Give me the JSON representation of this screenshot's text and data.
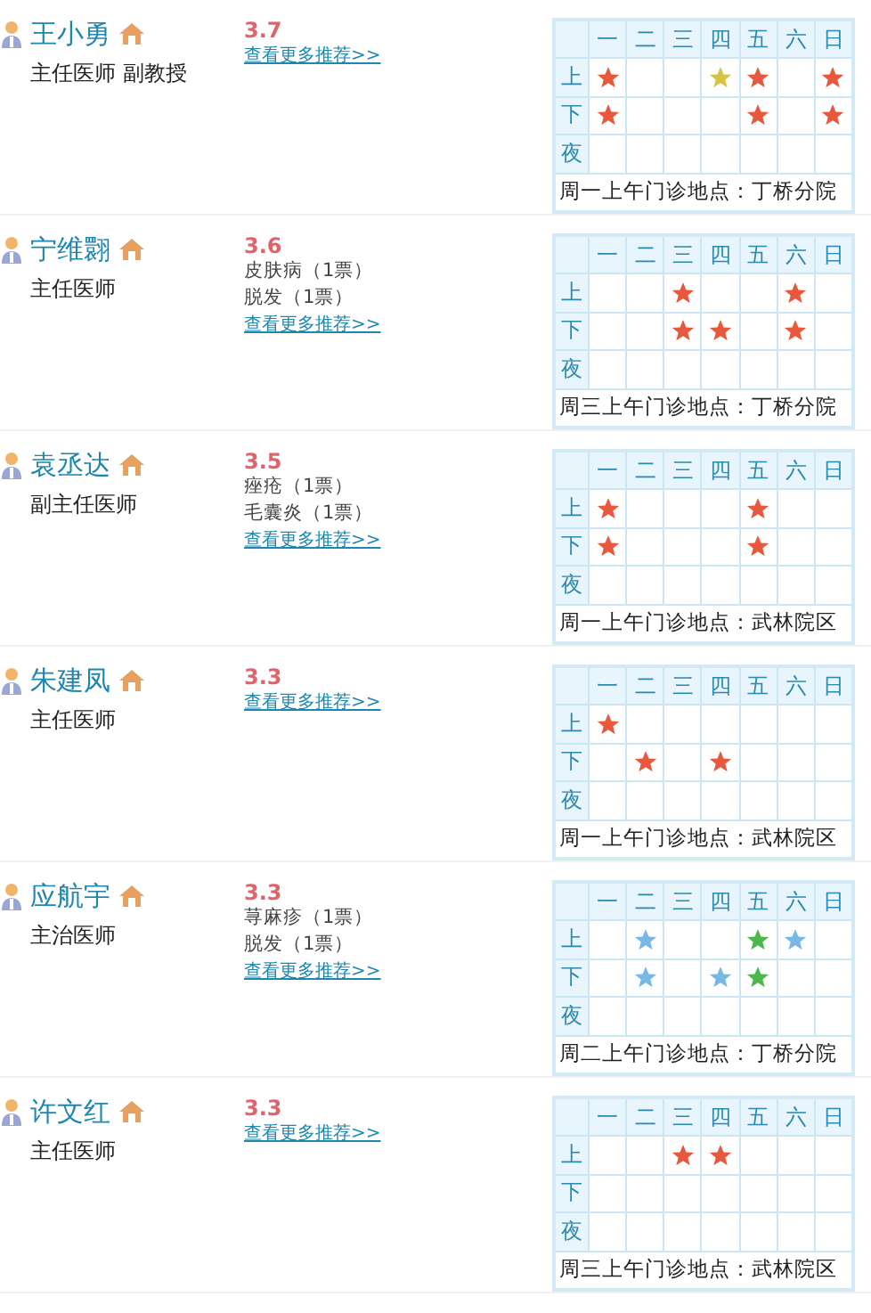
{
  "doctors": [
    {
      "name": "王小勇",
      "title": "主任医师 副教授",
      "rating": "3.7",
      "link": "查看更多推荐>>",
      "schedule": {
        "days": [
          "一",
          "二",
          "三",
          "四",
          "五",
          "六",
          "日"
        ],
        "rows": [
          {
            "label": "上",
            "cells": [
              {
                "star": true,
                "color": "#e8583c"
              },
              {
                "star": false
              },
              {
                "star": false
              },
              {
                "star": true,
                "color": "#d8c444"
              },
              {
                "star": true,
                "color": "#e8583c"
              },
              {
                "star": false
              },
              {
                "star": true,
                "color": "#e8583c"
              }
            ]
          },
          {
            "label": "下",
            "cells": [
              {
                "star": true,
                "color": "#e8583c"
              },
              {
                "star": false
              },
              {
                "star": false
              },
              {
                "star": false
              },
              {
                "star": true,
                "color": "#e8583c"
              },
              {
                "star": false
              },
              {
                "star": true,
                "color": "#e8583c"
              }
            ]
          },
          {
            "label": "夜",
            "cells": [
              {
                "star": false
              },
              {
                "star": false
              },
              {
                "star": false
              },
              {
                "star": false
              },
              {
                "star": false
              },
              {
                "star": false
              },
              {
                "star": false
              }
            ]
          }
        ],
        "note": "周一上午门诊地点：丁桥分院"
      }
    },
    {
      "name": "宁维翾",
      "title": "主任医师",
      "rating": "3.6",
      "votes": [
        "皮肤病（1票）",
        "脱发（1票）"
      ],
      "link": "查看更多推荐>>",
      "schedule": {
        "days": [
          "一",
          "二",
          "三",
          "四",
          "五",
          "六",
          "日"
        ],
        "rows": [
          {
            "label": "上",
            "cells": [
              {
                "star": false
              },
              {
                "star": false
              },
              {
                "star": true,
                "color": "#e8583c"
              },
              {
                "star": false
              },
              {
                "star": false
              },
              {
                "star": true,
                "color": "#e8583c"
              },
              {
                "star": false
              }
            ]
          },
          {
            "label": "下",
            "cells": [
              {
                "star": false
              },
              {
                "star": false
              },
              {
                "star": true,
                "color": "#e8583c"
              },
              {
                "star": true,
                "color": "#e8583c"
              },
              {
                "star": false
              },
              {
                "star": true,
                "color": "#e8583c"
              },
              {
                "star": false
              }
            ]
          },
          {
            "label": "夜",
            "cells": [
              {
                "star": false
              },
              {
                "star": false
              },
              {
                "star": false
              },
              {
                "star": false
              },
              {
                "star": false
              },
              {
                "star": false
              },
              {
                "star": false
              }
            ]
          }
        ],
        "note": "周三上午门诊地点：丁桥分院"
      }
    },
    {
      "name": "袁丞达",
      "title": "副主任医师",
      "rating": "3.5",
      "votes": [
        "痤疮（1票）",
        "毛囊炎（1票）"
      ],
      "link": "查看更多推荐>>",
      "schedule": {
        "days": [
          "一",
          "二",
          "三",
          "四",
          "五",
          "六",
          "日"
        ],
        "rows": [
          {
            "label": "上",
            "cells": [
              {
                "star": true,
                "color": "#e8583c"
              },
              {
                "star": false
              },
              {
                "star": false
              },
              {
                "star": false
              },
              {
                "star": true,
                "color": "#e8583c"
              },
              {
                "star": false
              },
              {
                "star": false
              }
            ]
          },
          {
            "label": "下",
            "cells": [
              {
                "star": true,
                "color": "#e8583c"
              },
              {
                "star": false
              },
              {
                "star": false
              },
              {
                "star": false
              },
              {
                "star": true,
                "color": "#e8583c"
              },
              {
                "star": false
              },
              {
                "star": false
              }
            ]
          },
          {
            "label": "夜",
            "cells": [
              {
                "star": false
              },
              {
                "star": false
              },
              {
                "star": false
              },
              {
                "star": false
              },
              {
                "star": false
              },
              {
                "star": false
              },
              {
                "star": false
              }
            ]
          }
        ],
        "note": "周一上午门诊地点：武林院区"
      }
    },
    {
      "name": "朱建凤",
      "title": "主任医师",
      "rating": "3.3",
      "link": "查看更多推荐>>",
      "schedule": {
        "days": [
          "一",
          "二",
          "三",
          "四",
          "五",
          "六",
          "日"
        ],
        "rows": [
          {
            "label": "上",
            "cells": [
              {
                "star": true,
                "color": "#e8583c"
              },
              {
                "star": false
              },
              {
                "star": false
              },
              {
                "star": false
              },
              {
                "star": false
              },
              {
                "star": false
              },
              {
                "star": false
              }
            ]
          },
          {
            "label": "下",
            "cells": [
              {
                "star": false
              },
              {
                "star": true,
                "color": "#e8583c"
              },
              {
                "star": false
              },
              {
                "star": true,
                "color": "#e8583c"
              },
              {
                "star": false
              },
              {
                "star": false
              },
              {
                "star": false
              }
            ]
          },
          {
            "label": "夜",
            "cells": [
              {
                "star": false
              },
              {
                "star": false
              },
              {
                "star": false
              },
              {
                "star": false
              },
              {
                "star": false
              },
              {
                "star": false
              },
              {
                "star": false
              }
            ]
          }
        ],
        "note": "周一上午门诊地点：武林院区"
      }
    },
    {
      "name": "应航宇",
      "title": "主治医师",
      "rating": "3.3",
      "votes": [
        "荨麻疹（1票）",
        "脱发（1票）"
      ],
      "link": "查看更多推荐>>",
      "schedule": {
        "days": [
          "一",
          "二",
          "三",
          "四",
          "五",
          "六",
          "日"
        ],
        "rows": [
          {
            "label": "上",
            "cells": [
              {
                "star": false
              },
              {
                "star": true,
                "color": "#78b8e4"
              },
              {
                "star": false
              },
              {
                "star": false
              },
              {
                "star": true,
                "color": "#4cb84c"
              },
              {
                "star": true,
                "color": "#78b8e4"
              },
              {
                "star": false
              }
            ]
          },
          {
            "label": "下",
            "cells": [
              {
                "star": false
              },
              {
                "star": true,
                "color": "#78b8e4"
              },
              {
                "star": false
              },
              {
                "star": true,
                "color": "#78b8e4"
              },
              {
                "star": true,
                "color": "#4cb84c"
              },
              {
                "star": false
              },
              {
                "star": false
              }
            ]
          },
          {
            "label": "夜",
            "cells": [
              {
                "star": false
              },
              {
                "star": false
              },
              {
                "star": false
              },
              {
                "star": false
              },
              {
                "star": false
              },
              {
                "star": false
              },
              {
                "star": false
              }
            ]
          }
        ],
        "note": "周二上午门诊地点：丁桥分院"
      }
    },
    {
      "name": "许文红",
      "title": "主任医师",
      "rating": "3.3",
      "link": "查看更多推荐>>",
      "schedule": {
        "days": [
          "一",
          "二",
          "三",
          "四",
          "五",
          "六",
          "日"
        ],
        "rows": [
          {
            "label": "上",
            "cells": [
              {
                "star": false
              },
              {
                "star": false
              },
              {
                "star": true,
                "color": "#e8583c"
              },
              {
                "star": true,
                "color": "#e8583c"
              },
              {
                "star": false
              },
              {
                "star": false
              },
              {
                "star": false
              }
            ]
          },
          {
            "label": "下",
            "cells": [
              {
                "star": false
              },
              {
                "star": false
              },
              {
                "star": false
              },
              {
                "star": false
              },
              {
                "star": false
              },
              {
                "star": false
              },
              {
                "star": false
              }
            ]
          },
          {
            "label": "夜",
            "cells": [
              {
                "star": false
              },
              {
                "star": false
              },
              {
                "star": false
              },
              {
                "star": false
              },
              {
                "star": false
              },
              {
                "star": false
              },
              {
                "star": false
              }
            ]
          }
        ],
        "note": "周三上午门诊地点：武林院区"
      }
    }
  ]
}
